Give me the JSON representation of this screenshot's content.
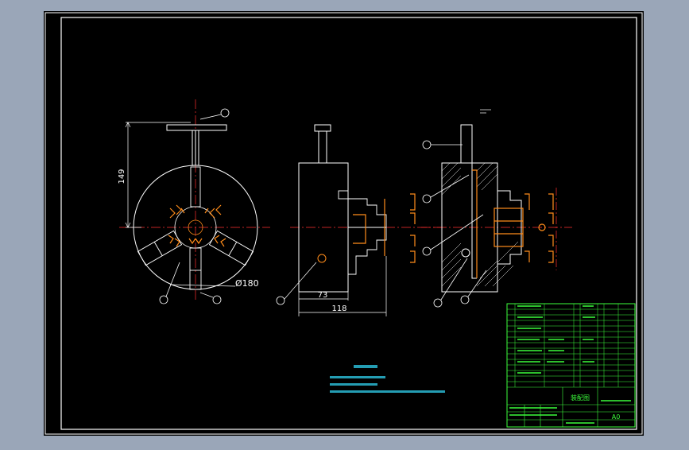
{
  "viewport": {
    "background_color": "#9aa6b8",
    "canvas_color": "#000000",
    "line_color": "#ffffff",
    "accent_color": "#ff8c1a",
    "centerline_color": "#ff3030",
    "table_color": "#3cff3c",
    "notes_color": "#33e0ff"
  },
  "front_view": {
    "dimension_height": "149",
    "dimension_diameter": "Ø180"
  },
  "side_view": {
    "dimension_inner": "73",
    "dimension_outer": "118"
  },
  "title_block": {
    "drawing_title": "装配图",
    "sheet_size": "A0"
  }
}
